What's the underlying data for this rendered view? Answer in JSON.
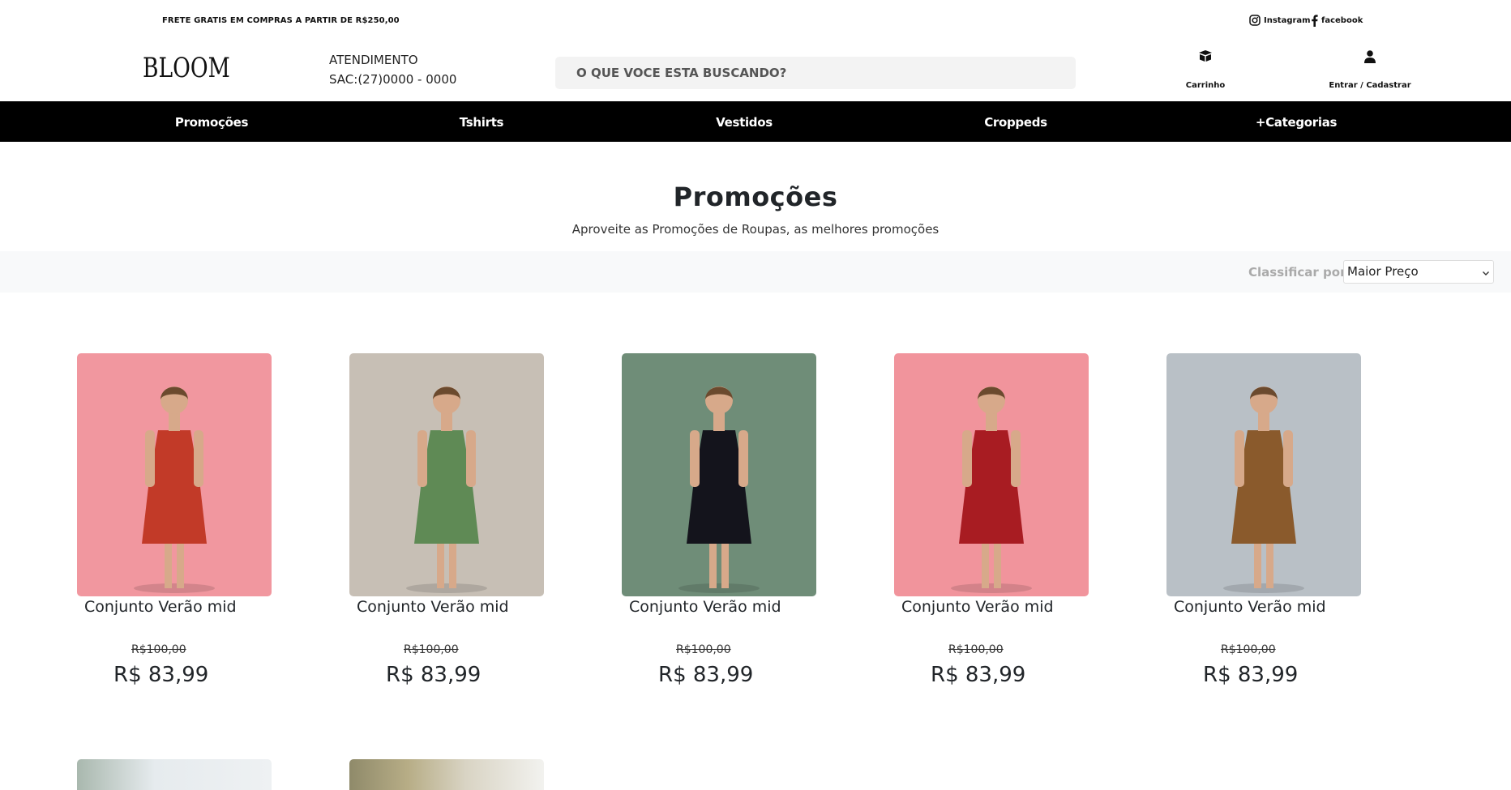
{
  "topbar": {
    "promo": "FRETE GRATIS EM COMPRAS A PARTIR DE R$250,00",
    "instagram": "Instagram",
    "facebook": "facebook"
  },
  "header": {
    "logo": "BLOOM",
    "atendimento_title": "ATENDIMENTO",
    "atendimento_phone": "SAC:(27)0000 - 0000",
    "search_placeholder": "O QUE VOCE ESTA BUSCANDO?",
    "cart_label": "Carrinho",
    "account_label": "Entrar / Cadastrar"
  },
  "nav": {
    "items": [
      "Promoções",
      "Tshirts",
      "Vestidos",
      "Croppeds",
      "+Categorias"
    ]
  },
  "page": {
    "title": "Promoções",
    "subtitle": "Aproveite as Promoções de Roupas, as melhores promoções"
  },
  "sort": {
    "label": "Classificar por",
    "selected": "Maior Preço"
  },
  "products": [
    {
      "name": "Conjunto Verão mid",
      "old_price": "R$100,00",
      "price": "R$ 83,99",
      "bg": "#f1979f",
      "outfit": "#c23a28"
    },
    {
      "name": "Conjunto Verão mid",
      "old_price": "R$100,00",
      "price": "R$ 83,99",
      "bg": "#c7bfb5",
      "outfit": "#5f8a55"
    },
    {
      "name": "Conjunto Verão mid",
      "old_price": "R$100,00",
      "price": "R$ 83,99",
      "bg": "#6f8d78",
      "outfit": "#14141c"
    },
    {
      "name": "Conjunto Verão mid",
      "old_price": "R$100,00",
      "price": "R$ 83,99",
      "bg": "#f1949c",
      "outfit": "#a81c22"
    },
    {
      "name": "Conjunto Verão mid",
      "old_price": "R$100,00",
      "price": "R$ 83,99",
      "bg": "#b9c0c6",
      "outfit": "#8a5a2c"
    }
  ],
  "colors": {
    "nav_bg": "#000000",
    "sortbar_bg": "#f8f9fa",
    "search_bg": "#f3f3f3"
  }
}
